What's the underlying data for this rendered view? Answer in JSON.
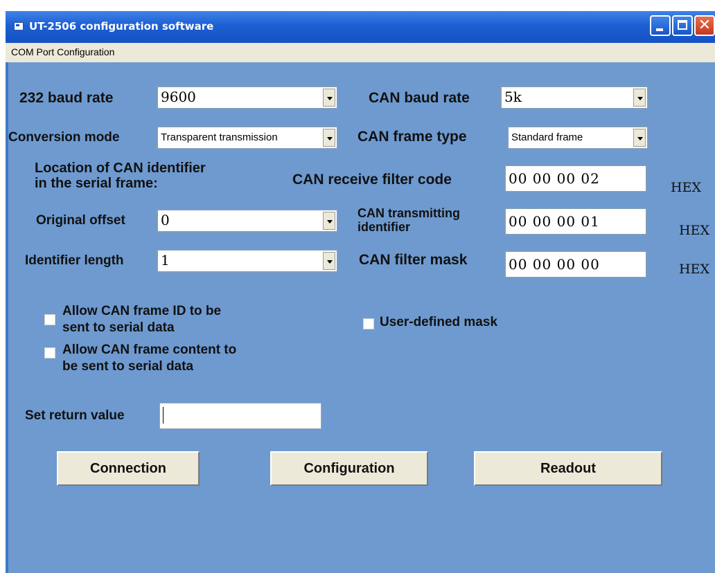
{
  "window": {
    "title": "UT-2506 configuration software"
  },
  "menu": {
    "com_port": "COM Port Configuration"
  },
  "left": {
    "baud_label": "232 baud rate",
    "baud_value": "9600",
    "mode_label": "Conversion mode",
    "mode_value": "Transparent transmission",
    "location_line1": "Location of CAN identifier",
    "location_line2": "in the serial frame:",
    "offset_label": "Original offset",
    "offset_value": "0",
    "idlen_label": "Identifier length",
    "idlen_value": "1"
  },
  "right": {
    "can_baud_label": "CAN baud rate",
    "can_baud_value": "5k",
    "frame_type_label": "CAN frame type",
    "frame_type_value": "Standard frame",
    "filter_code_label": "CAN receive filter code",
    "filter_code_value": "00  00  00  02",
    "tx_id_line1": "CAN transmitting",
    "tx_id_line2": "identifier",
    "tx_id_value": "00  00  00  01",
    "mask_label": "CAN filter mask",
    "mask_value": "00  00  00  00",
    "hex_unit": "HEX"
  },
  "checkboxes": {
    "id_line1": "Allow CAN frame ID to be",
    "id_line2": "sent to serial data",
    "content_line1": "Allow CAN frame content to",
    "content_line2": "be sent to serial data",
    "user_mask": "User-defined mask"
  },
  "return": {
    "label": "Set return value",
    "value": ""
  },
  "buttons": {
    "connection": "Connection",
    "configuration": "Configuration",
    "readout": "Readout"
  }
}
